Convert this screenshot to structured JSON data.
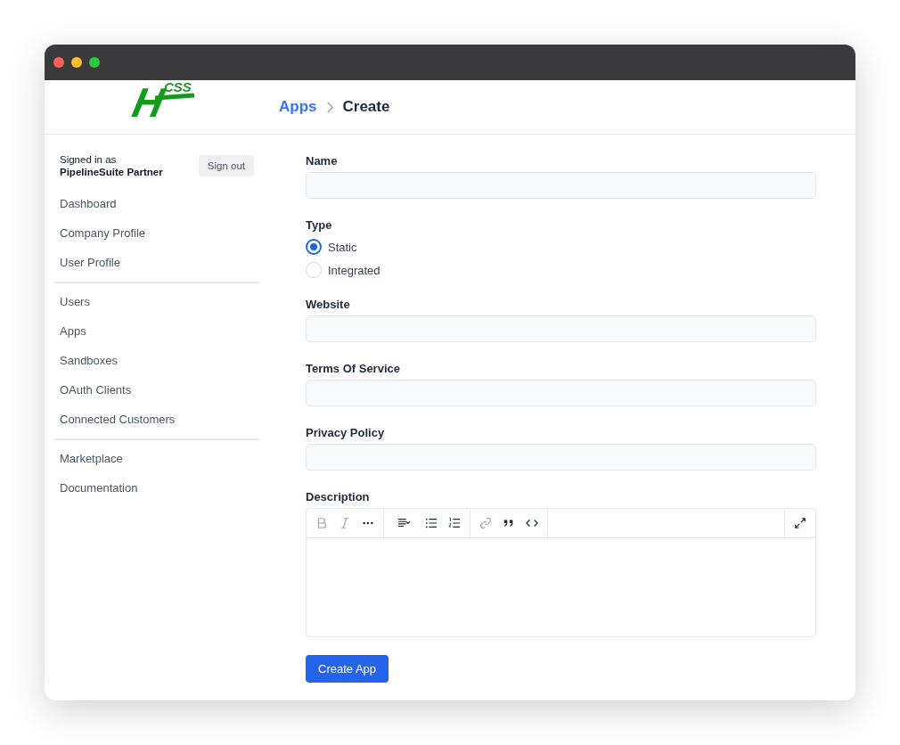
{
  "logo": {
    "letter": "H",
    "sub": "CSS"
  },
  "breadcrumb": [
    {
      "label": "Apps",
      "kind": "link"
    },
    {
      "label": "Create",
      "kind": "current"
    }
  ],
  "account": {
    "caption": "Signed in as",
    "name": "PipelineSuite Partner",
    "sign_out": "Sign out"
  },
  "sidebar": {
    "groups": [
      {
        "items": [
          {
            "label": "Dashboard"
          },
          {
            "label": "Company Profile"
          },
          {
            "label": "User Profile"
          }
        ]
      },
      {
        "items": [
          {
            "label": "Users"
          },
          {
            "label": "Apps"
          },
          {
            "label": "Sandboxes"
          },
          {
            "label": "OAuth Clients"
          },
          {
            "label": "Connected Customers"
          }
        ]
      },
      {
        "items": [
          {
            "label": "Marketplace"
          },
          {
            "label": "Documentation"
          }
        ]
      }
    ]
  },
  "form": {
    "fields": [
      {
        "kind": "text",
        "label": "Name"
      },
      {
        "kind": "radio",
        "label": "Type",
        "options": [
          {
            "label": "Static",
            "selected": true
          },
          {
            "label": "Integrated",
            "selected": false
          }
        ]
      },
      {
        "kind": "text",
        "label": "Website"
      },
      {
        "kind": "text",
        "label": "Terms Of Service"
      },
      {
        "kind": "text",
        "label": "Privacy Policy"
      },
      {
        "kind": "editor",
        "label": "Description",
        "toolbar": [
          [
            {
              "kind": "bold",
              "disabled": true
            },
            {
              "kind": "italic",
              "disabled": true
            },
            {
              "kind": "more",
              "disabled": false
            }
          ],
          [
            {
              "kind": "align",
              "disabled": false
            },
            {
              "kind": "bullets",
              "disabled": false
            },
            {
              "kind": "numbers",
              "disabled": false
            }
          ],
          [
            {
              "kind": "link",
              "disabled": true
            },
            {
              "kind": "quote",
              "disabled": false
            },
            {
              "kind": "code",
              "disabled": false
            }
          ]
        ]
      }
    ],
    "submit": "Create App"
  }
}
